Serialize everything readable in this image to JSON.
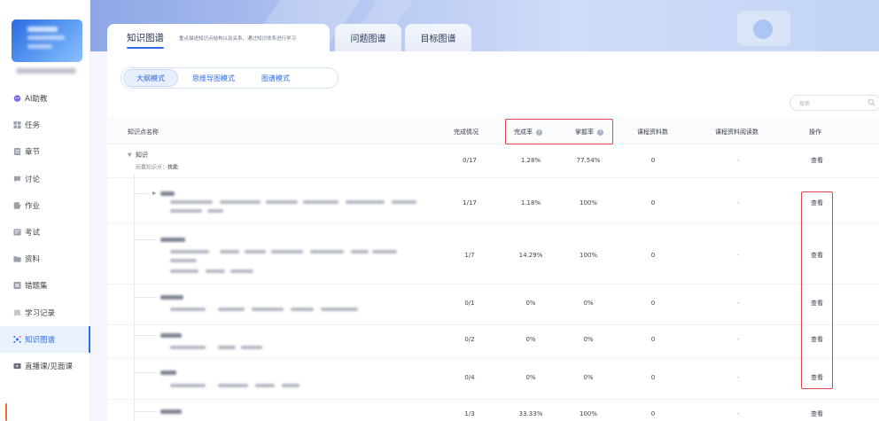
{
  "sidebar": {
    "items": [
      {
        "label": "AI助教",
        "icon": "ai-assistant-icon",
        "color": "#6f5de6"
      },
      {
        "label": "任务",
        "icon": "task-icon",
        "color": "#8f96a3"
      },
      {
        "label": "章节",
        "icon": "chapter-icon",
        "color": "#8f96a3"
      },
      {
        "label": "讨论",
        "icon": "discussion-icon",
        "color": "#8f96a3"
      },
      {
        "label": "作业",
        "icon": "homework-icon",
        "color": "#8f96a3"
      },
      {
        "label": "考试",
        "icon": "exam-icon",
        "color": "#8f96a3"
      },
      {
        "label": "资料",
        "icon": "materials-icon",
        "color": "#8f96a3"
      },
      {
        "label": "错题集",
        "icon": "wrong-questions-icon",
        "color": "#8f96a3"
      },
      {
        "label": "学习记录",
        "icon": "study-record-icon",
        "color": "#8f96a3"
      },
      {
        "label": "知识图谱",
        "icon": "knowledge-graph-icon",
        "color": "#2c6be3"
      },
      {
        "label": "直播课/见面课",
        "icon": "live-class-icon",
        "color": "#8f96a3"
      }
    ]
  },
  "tabs": {
    "knowledge": "知识图谱",
    "knowledge_desc": "重点描述知识点结构以及关系，通过知识体系进行学习",
    "question": "问题图谱",
    "goal": "目标图谱"
  },
  "modes": [
    "大纲模式",
    "思维导图模式",
    "图谱模式"
  ],
  "search": {
    "placeholder": "搜索"
  },
  "table": {
    "headers": {
      "name": "知识点名称",
      "completion": "完成情况",
      "completion_rate": "完成率",
      "mastery_rate": "掌握率",
      "course_materials": "课程资料数",
      "materials_read": "课程资料阅读数",
      "action": "操作"
    },
    "root": {
      "name": "知识",
      "prereq_label": "后置知识点：",
      "prereq_value": "技能",
      "completion": "0/17",
      "completion_rate": "1.28%",
      "mastery_rate": "77.54%",
      "materials": "0",
      "read": "-",
      "action": "查看"
    },
    "rows": [
      {
        "completion": "1/17",
        "completion_rate": "1.18%",
        "mastery_rate": "100%",
        "materials": "0",
        "read": "-",
        "action": "查看"
      },
      {
        "completion": "1/7",
        "completion_rate": "14.29%",
        "mastery_rate": "100%",
        "materials": "0",
        "read": "-",
        "action": "查看"
      },
      {
        "completion": "0/1",
        "completion_rate": "0%",
        "mastery_rate": "0%",
        "materials": "0",
        "read": "-",
        "action": "查看"
      },
      {
        "completion": "0/2",
        "completion_rate": "0%",
        "mastery_rate": "0%",
        "materials": "0",
        "read": "-",
        "action": "查看"
      },
      {
        "completion": "0/4",
        "completion_rate": "0%",
        "mastery_rate": "0%",
        "materials": "0",
        "read": "-",
        "action": "查看"
      },
      {
        "completion": "1/3",
        "completion_rate": "33.33%",
        "mastery_rate": "100%",
        "materials": "0",
        "read": "-",
        "action": "查看"
      }
    ]
  },
  "colors": {
    "accent": "#2c6be3",
    "highlight": "#e0454d",
    "info": "#a9b3c4"
  }
}
